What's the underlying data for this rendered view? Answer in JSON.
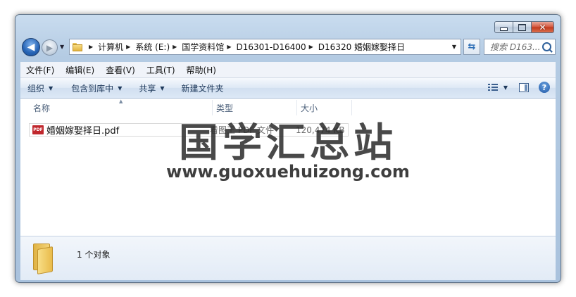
{
  "window": {
    "caption": {
      "close_glyph": "✕"
    },
    "back_glyph": "◀",
    "forward_glyph": "▶"
  },
  "address": {
    "crumbs": [
      "计算机",
      "系统 (E:)",
      "国学资料馆",
      "D16301-D16400",
      "D16320 婚姻嫁娶择日"
    ]
  },
  "search": {
    "placeholder": "搜索 D163..."
  },
  "menubar": {
    "items": [
      "文件(F)",
      "编辑(E)",
      "查看(V)",
      "工具(T)",
      "帮助(H)"
    ]
  },
  "commandbar": {
    "organize": "组织",
    "include_in_library": "包含到库中",
    "share": "共享",
    "new_folder": "新建文件夹",
    "help_glyph": "?"
  },
  "columns": {
    "name": "名称",
    "type": "类型",
    "size": "大小"
  },
  "files": [
    {
      "icon": "pdf-icon",
      "icon_text": "PDF",
      "name": "婚姻嫁娶择日.pdf",
      "type": "看图王 PDF 文件",
      "size": "120,474 KB"
    }
  ],
  "watermark": {
    "title": "国学汇总站",
    "url": "www.guoxuehuizong.com"
  },
  "details": {
    "count_text": "1 个对象"
  },
  "colors": {
    "accent": "#2563b5",
    "pdf_red": "#c0272d",
    "close_red": "#c0391c"
  }
}
